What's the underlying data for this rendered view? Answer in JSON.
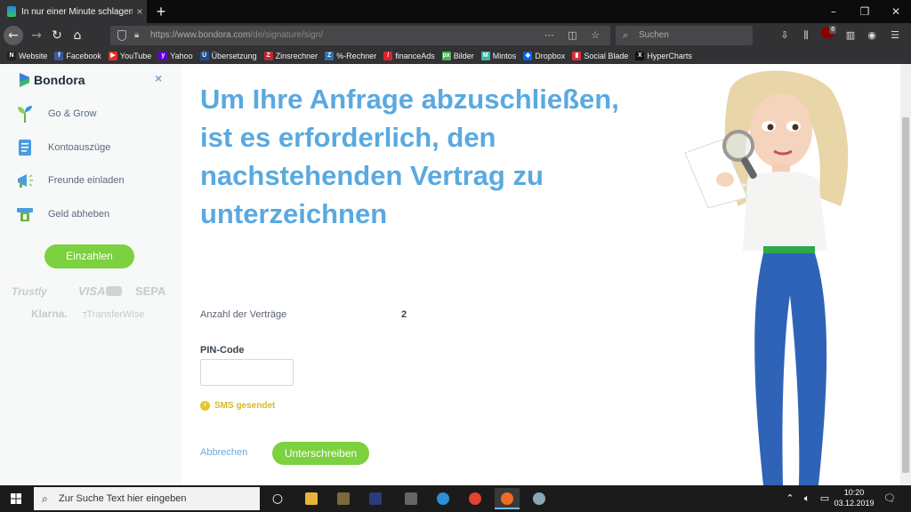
{
  "browser": {
    "tab_title": "In nur einer Minute schlagen Sie",
    "tab_close": "×",
    "newtab": "+",
    "url_base": "https://www.bondora.com",
    "url_path": "/de/signature/sign/",
    "search_placeholder": "Suchen",
    "ublock_badge": "6"
  },
  "bookmarks": [
    {
      "label": "Website",
      "color": "#222222",
      "glyph": "N"
    },
    {
      "label": "Facebook",
      "color": "#3b5998",
      "glyph": "f"
    },
    {
      "label": "YouTube",
      "color": "#e52d27",
      "glyph": "▶"
    },
    {
      "label": "Yahoo",
      "color": "#6001d2",
      "glyph": "y"
    },
    {
      "label": "Übersetzung",
      "color": "#1f4e8c",
      "glyph": "Ü"
    },
    {
      "label": "Zinsrechner",
      "color": "#c0272d",
      "glyph": "Z"
    },
    {
      "label": "%-Rechner",
      "color": "#2a6fb0",
      "glyph": "Z"
    },
    {
      "label": "financeAds",
      "color": "#d9232e",
      "glyph": "/"
    },
    {
      "label": "Bilder",
      "color": "#4caf50",
      "glyph": "px"
    },
    {
      "label": "Mintos",
      "color": "#3fb7a3",
      "glyph": "M"
    },
    {
      "label": "Dropbox",
      "color": "#0061fe",
      "glyph": "◆"
    },
    {
      "label": "Social Blade",
      "color": "#d6313b",
      "glyph": "▮"
    },
    {
      "label": "HyperCharts",
      "color": "#111111",
      "glyph": "X"
    }
  ],
  "sidebar": {
    "brand": "Bondora",
    "close": "×",
    "items": [
      {
        "label": "Go & Grow"
      },
      {
        "label": "Kontoauszüge"
      },
      {
        "label": "Freunde einladen"
      },
      {
        "label": "Geld abheben"
      }
    ],
    "deposit_button": "Einzahlen",
    "payment_logos": [
      "Trustly",
      "VISA",
      "SEPA",
      "Klarna.",
      "TransferWise"
    ]
  },
  "main": {
    "headline": "Um Ihre Anfrage abzuschließen, ist es erforderlich, den nachstehenden Vertrag zu unterzeichnen",
    "contracts_label": "Anzahl der Verträge",
    "contracts_value": "2",
    "pin_label": "PIN-Code",
    "pin_value": "",
    "sms_status": "SMS gesendet",
    "cancel_link": "Abbrechen",
    "sign_button": "Unterschreiben"
  },
  "taskbar": {
    "search_placeholder": "Zur Suche Text hier eingeben",
    "time": "10:20",
    "date": "03.12.2019"
  },
  "colors": {
    "accent_green": "#7bd13e",
    "headline_blue": "#5aa9e0",
    "sms_yellow": "#d8b821"
  }
}
